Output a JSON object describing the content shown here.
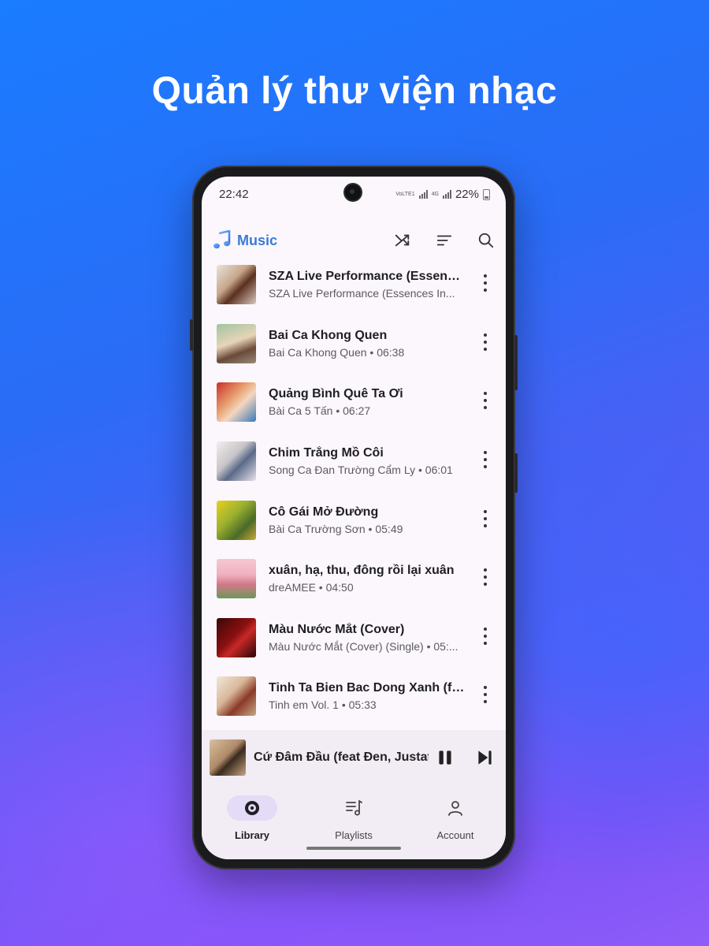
{
  "headline": "Quản lý thư viện nhạc",
  "status_bar": {
    "time": "22:42",
    "network_1": "VoLTE1",
    "network_2": "4G",
    "battery": "22%"
  },
  "app_bar": {
    "app_name": "Music",
    "brand_color": "#3a7bd5",
    "actions": [
      "shuffle-icon",
      "sort-icon",
      "search-icon"
    ]
  },
  "songs": [
    {
      "title": "SZA Live Performance (Essences In...",
      "subtitle": "SZA Live Performance (Essences In..."
    },
    {
      "title": "Bai Ca Khong Quen",
      "subtitle": "Bai Ca Khong Quen • 06:38"
    },
    {
      "title": "Quảng Bình Quê Ta Ơi",
      "subtitle": "Bài Ca 5 Tấn • 06:27"
    },
    {
      "title": "Chim Trắng Mồ Côi",
      "subtitle": "Song Ca Đan Trường Cẩm Ly • 06:01"
    },
    {
      "title": "Cô Gái Mở Đường",
      "subtitle": "Bài Ca Trường Sơn • 05:49"
    },
    {
      "title": "xuân, hạ, thu, đông rồi lại xuân",
      "subtitle": "dreAMEE • 04:50"
    },
    {
      "title": "Màu Nước Mắt (Cover)",
      "subtitle": "Màu Nước Mắt (Cover) (Single) • 05:..."
    },
    {
      "title": "Tinh Ta Bien Bac Dong Xanh (ft....",
      "subtitle": "Tinh em Vol. 1 • 05:33"
    }
  ],
  "now_playing": {
    "title": "Cứ Đâm Đầu (feat Đen, Justatee)",
    "state": "playing"
  },
  "bottom_nav": {
    "items": [
      {
        "label": "Library",
        "icon": "disc-icon",
        "active": true
      },
      {
        "label": "Playlists",
        "icon": "playlist-icon",
        "active": false
      },
      {
        "label": "Account",
        "icon": "person-icon",
        "active": false
      }
    ]
  }
}
